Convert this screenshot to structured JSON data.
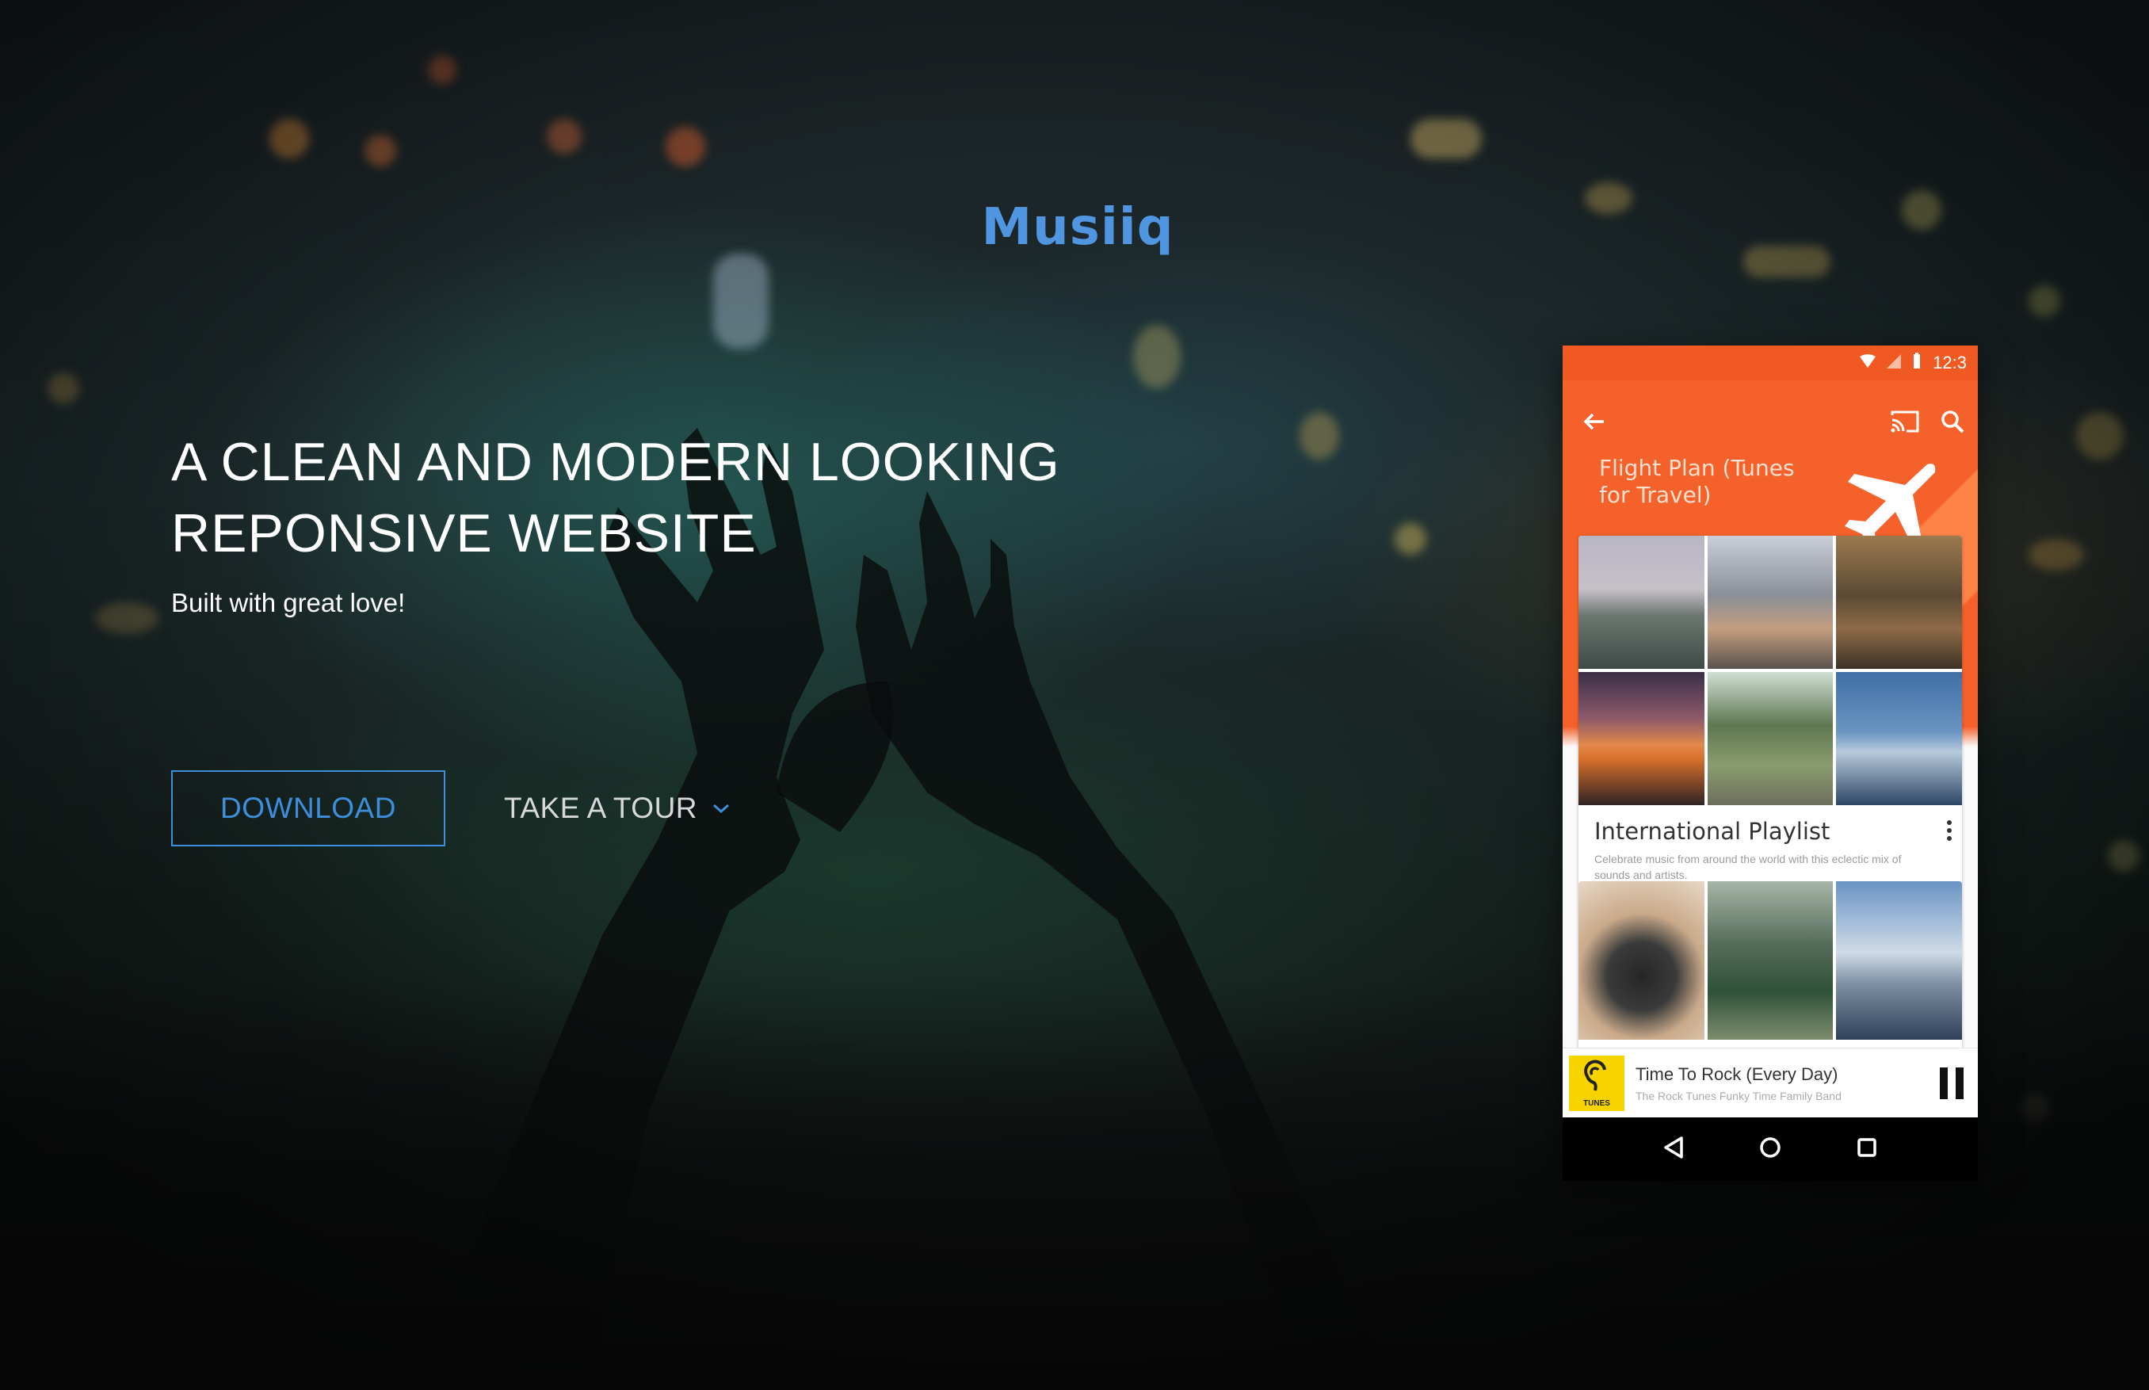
{
  "brand": {
    "logo_text": "Musiiq",
    "logo_color": "#4f95e0"
  },
  "hero": {
    "headline_line1": "A CLEAN AND MODERN LOOKING",
    "headline_line2": "REPONSIVE WEBSITE",
    "tagline": "Built with great love!",
    "download_label": "DOWNLOAD",
    "tour_label": "TAKE A TOUR",
    "accent_color": "#3d8fdc"
  },
  "phone": {
    "status_time": "12:3",
    "accent_color": "#f5612a",
    "playlist_header": "Flight Plan (Tunes for Travel)",
    "card": {
      "title": "International Playlist",
      "description": "Celebrate music from around the world with this eclectic mix of sounds and artists."
    },
    "now_playing": {
      "art_label": "TUNES",
      "song": "Time To Rock (Every Day)",
      "artist": "The Rock Tunes Funky Time Family Band"
    },
    "icons": [
      "back-arrow-icon",
      "cast-icon",
      "search-icon",
      "airplane-icon",
      "more-vert-icon",
      "ear-icon",
      "pause-icon",
      "nav-back-icon",
      "nav-home-icon",
      "nav-recents-icon",
      "wifi-icon",
      "signal-icon",
      "battery-icon"
    ]
  }
}
